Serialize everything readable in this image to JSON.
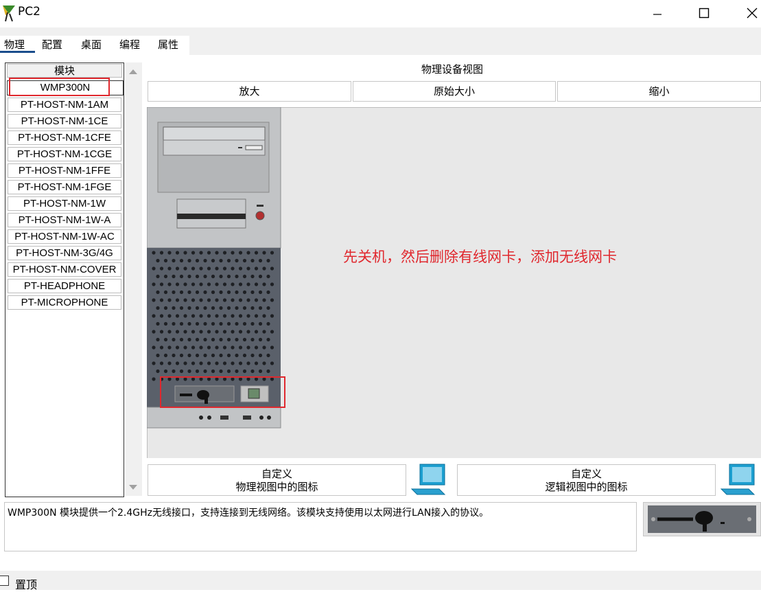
{
  "window": {
    "title": "PC2",
    "controls": [
      "minimize-icon",
      "maximize-icon",
      "close-icon"
    ]
  },
  "tabs": [
    {
      "label": "物理",
      "active": true
    },
    {
      "label": "配置",
      "active": false
    },
    {
      "label": "桌面",
      "active": false
    },
    {
      "label": "编程",
      "active": false
    },
    {
      "label": "属性",
      "active": false
    }
  ],
  "modules": {
    "header": "模块",
    "selected": "WMP300N",
    "items": [
      "PT-HOST-NM-1AM",
      "PT-HOST-NM-1CE",
      "PT-HOST-NM-1CFE",
      "PT-HOST-NM-1CGE",
      "PT-HOST-NM-1FFE",
      "PT-HOST-NM-1FGE",
      "PT-HOST-NM-1W",
      "PT-HOST-NM-1W-A",
      "PT-HOST-NM-1W-AC",
      "PT-HOST-NM-3G/4G",
      "PT-HOST-NM-COVER",
      "PT-HEADPHONE",
      "PT-MICROPHONE"
    ]
  },
  "physical_view": {
    "title": "物理设备视图",
    "zoom_in": "放大",
    "original_size": "原始大小",
    "zoom_out": "缩小",
    "annotation": "先关机，然后删除有线网卡，添加无线网卡"
  },
  "custom_icons": {
    "physical": {
      "line1": "自定义",
      "line2": "物理视图中的图标"
    },
    "logical": {
      "line1": "自定义",
      "line2": "逻辑视图中的图标"
    }
  },
  "description": "WMP300N 模块提供一个2.4GHz无线接口，支持连接到无线网络。该模块支持使用以太网进行LAN接入的协议。",
  "pin": {
    "label": "置顶",
    "checked": false
  },
  "colors": {
    "annotation_red": "#e0282e",
    "tab_underline": "#1a4d8c",
    "panel_bg": "#f0f0f0"
  }
}
